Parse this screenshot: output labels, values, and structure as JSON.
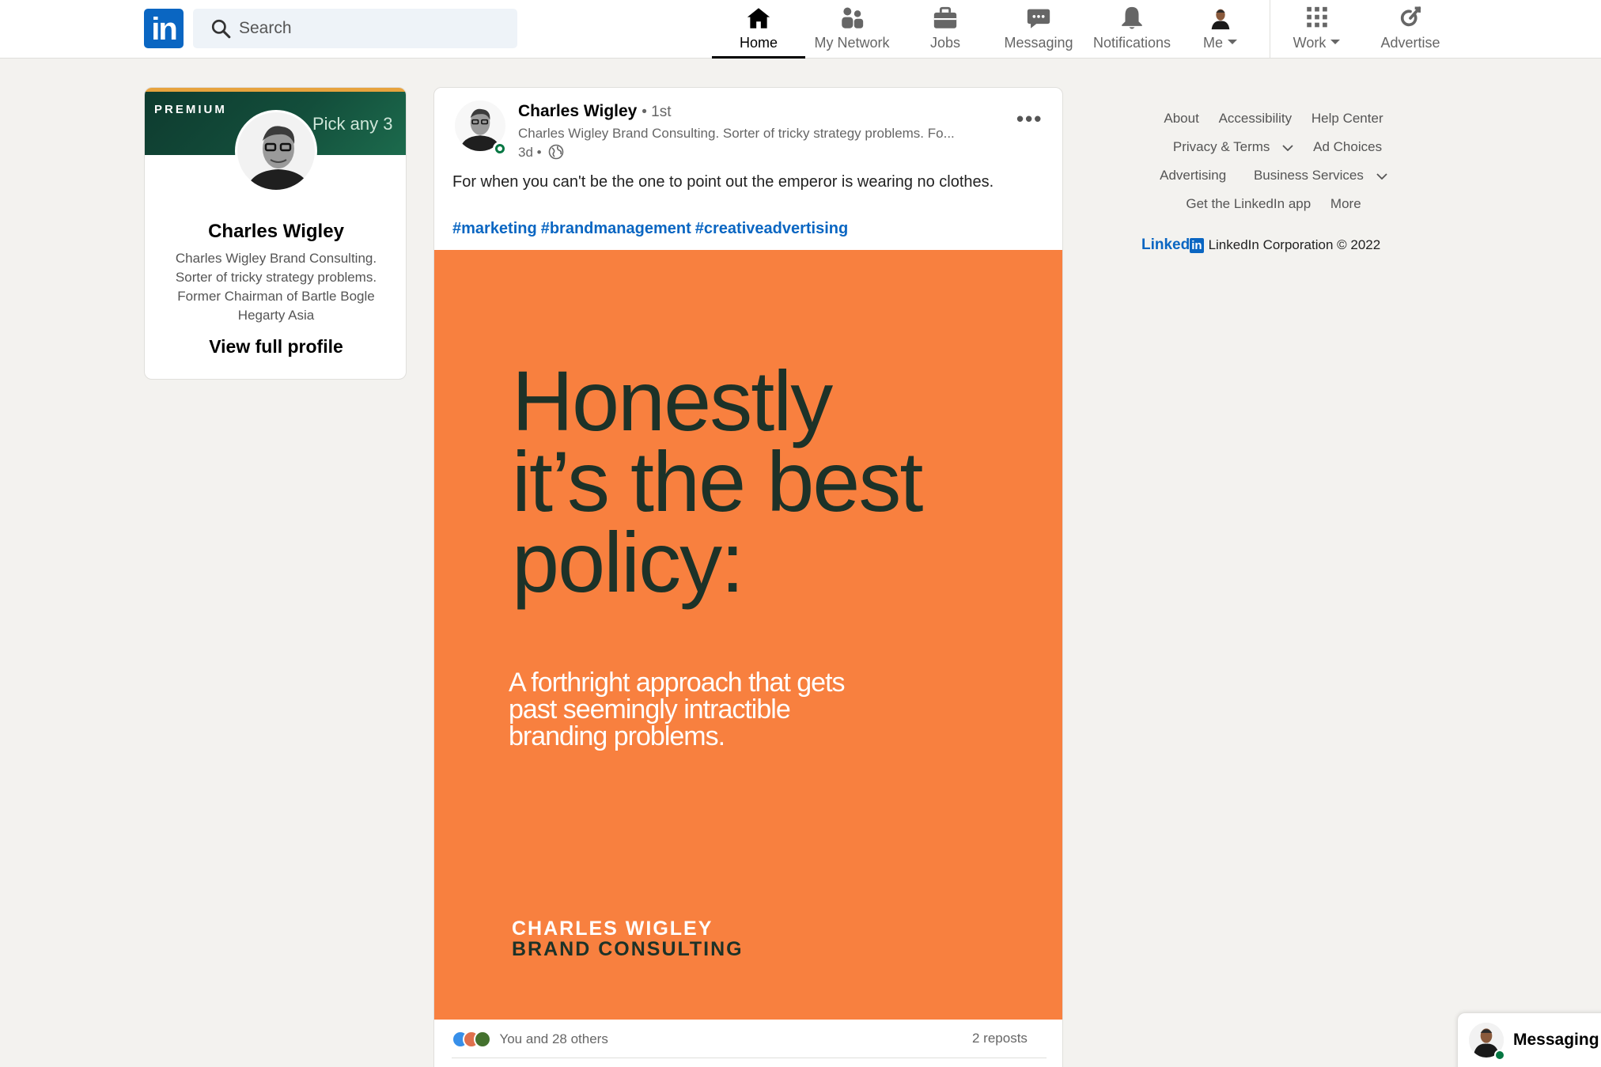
{
  "nav": {
    "logo_text": "in",
    "search_placeholder": "Search",
    "items": [
      {
        "label": "Home",
        "icon": "home-icon",
        "active": true
      },
      {
        "label": "My Network",
        "icon": "network-icon"
      },
      {
        "label": "Jobs",
        "icon": "briefcase-icon"
      },
      {
        "label": "Messaging",
        "icon": "message-icon"
      },
      {
        "label": "Notifications",
        "icon": "bell-icon"
      },
      {
        "label": "Me",
        "icon": "avatar-icon"
      },
      {
        "label": "Work",
        "icon": "grid-icon"
      },
      {
        "label": "Advertise",
        "icon": "advertise-icon"
      }
    ]
  },
  "profile": {
    "banner_badge": "PREMIUM",
    "banner_text": "Pick any 3",
    "name": "Charles Wigley",
    "headline": "Charles Wigley Brand Consulting. Sorter of tricky strategy problems. Former Chairman of Bartle Bogle Hegarty Asia",
    "view_profile": "View full profile"
  },
  "post": {
    "author": "Charles Wigley",
    "degree": "• 1st",
    "author_sub": "Charles Wigley Brand Consulting. Sorter of tricky strategy problems. Fo...",
    "age": "3d •",
    "text": "For when you can't be the one to point out the emperor is wearing no clothes.",
    "hashtags": [
      "#marketing",
      "#brandmanagement",
      "#creativeadvertising"
    ],
    "image": {
      "headline_lines": [
        "Honestly",
        "it’s the best",
        "policy:"
      ],
      "sub_lines": [
        "A forthright approach that gets",
        "past seemingly intractible",
        "branding problems."
      ],
      "brand_line1": "CHARLES WIGLEY",
      "brand_line2": "BRAND CONSULTING",
      "background": "#f8803f"
    },
    "reactions_text": "You and 28 others",
    "reposts": "2 reposts"
  },
  "footer": {
    "row1": [
      "About",
      "Accessibility",
      "Help Center"
    ],
    "row2": [
      "Privacy & Terms",
      "Ad Choices"
    ],
    "row3": [
      "Advertising",
      "Business Services"
    ],
    "row4": [
      "Get the LinkedIn app",
      "More"
    ],
    "logo_word": "Linked",
    "logo_box": "in",
    "copyright": "LinkedIn Corporation © 2022"
  },
  "messaging": {
    "label": "Messaging"
  },
  "colors": {
    "brand_blue": "#0a66c2",
    "image_orange": "#f8803f",
    "image_dark_green": "#1d3228",
    "online_green": "#057642"
  }
}
